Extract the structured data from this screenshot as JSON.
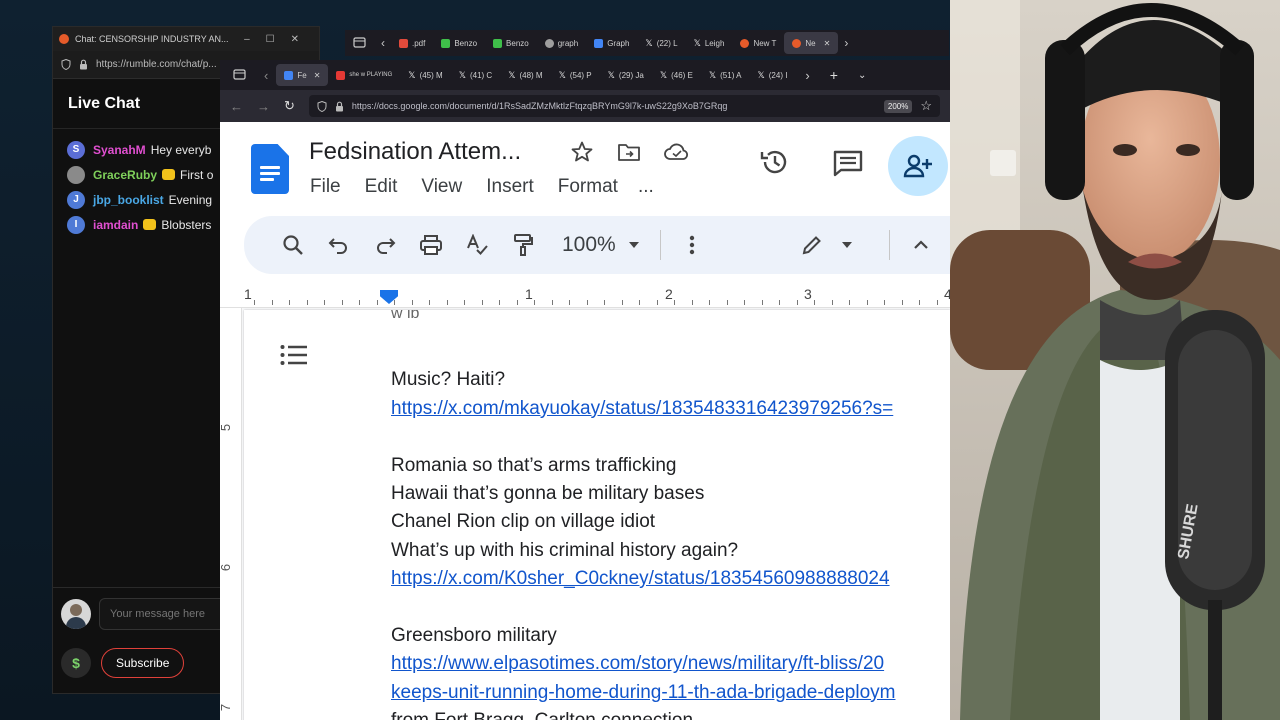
{
  "back_window": {
    "title": "Chat: CENSORSHIP INDUSTRY AN...",
    "url": "https://rumble.com/chat/p...",
    "controls": [
      "–",
      "☐",
      "✕"
    ]
  },
  "live_chat": {
    "title": "Live Chat",
    "messages": [
      {
        "initial": "S",
        "user": "SyanahM",
        "message": "Hey everyb",
        "avatar_color": "#5b6ed6",
        "user_color": "#e04fd0",
        "badge": false
      },
      {
        "initial": "",
        "user": "GraceRuby",
        "message": "First o",
        "avatar_color": "#8a8a8a",
        "user_color": "#7fd05b",
        "badge": true
      },
      {
        "initial": "J",
        "user": "jbp_booklist",
        "message": "Evening",
        "avatar_color": "#4f7ad6",
        "user_color": "#4aa8e6",
        "badge": false
      },
      {
        "initial": "I",
        "user": "iamdain",
        "message": "Blobsters",
        "avatar_color": "#4f7ad6",
        "user_color": "#e04fd0",
        "badge": true
      }
    ],
    "input_placeholder": "Your message here",
    "dollar_label": "$",
    "subscribe_label": "Subscribe"
  },
  "back_tabs": [
    {
      "label": ".pdf",
      "color": "#e24a3b"
    },
    {
      "label": "Benzo",
      "color": "#3fbf4a"
    },
    {
      "label": "Benzo",
      "color": "#3fbf4a"
    },
    {
      "label": "graph",
      "color": "#9e9e9e"
    },
    {
      "label": "Graph",
      "color": "#4285f4"
    },
    {
      "label": "(22) L",
      "color": "#eeeeee"
    },
    {
      "label": "Leigh",
      "color": "#eeeeee"
    },
    {
      "label": "New T",
      "color": "#e65b2a"
    },
    {
      "label": "Ne",
      "color": "#e65b2a"
    }
  ],
  "front_tabs": [
    {
      "label": "Fe",
      "color": "#4285f4"
    },
    {
      "label": "she w PLAYING",
      "color": "#e53935"
    },
    {
      "label": "(45) M",
      "color": "#eeeeee"
    },
    {
      "label": "(41) C",
      "color": "#eeeeee"
    },
    {
      "label": "(48) M",
      "color": "#eeeeee"
    },
    {
      "label": "(54) P",
      "color": "#eeeeee"
    },
    {
      "label": "(29) Ja",
      "color": "#eeeeee"
    },
    {
      "label": "(46) E",
      "color": "#eeeeee"
    },
    {
      "label": "(51) A",
      "color": "#eeeeee"
    },
    {
      "label": "(24) I",
      "color": "#eeeeee"
    }
  ],
  "front_url": "https://docs.google.com/document/d/1RsSadZMzMktlzFtqzqBRYmG9l7k-uwS22g9XoB7GRqg",
  "browser_zoom": "200%",
  "docs": {
    "title": "Fedsination Attem...",
    "menu": [
      "File",
      "Edit",
      "View",
      "Insert",
      "Format",
      "..."
    ],
    "zoom": "100%",
    "ruler_numbers": [
      "1",
      "1",
      "2",
      "3",
      "4"
    ],
    "vruler_numbers": [
      "5",
      "6",
      "7"
    ],
    "top_cut_text": "w ib",
    "lines": [
      {
        "text": "",
        "link": false
      },
      {
        "text": "Music? Haiti?",
        "link": false
      },
      {
        "text": "https://x.com/mkayuokay/status/1835483316423979256?s=",
        "link": true
      },
      {
        "text": "",
        "link": false
      },
      {
        "text": "Romania so that’s arms trafficking",
        "link": false
      },
      {
        "text": "Hawaii that’s gonna be military bases",
        "link": false
      },
      {
        "text": "Chanel Rion clip on village idiot",
        "link": false
      },
      {
        "text": "What’s up with his criminal history again?",
        "link": false
      },
      {
        "text": "https://x.com/K0sher_C0ckney/status/18354560988888024",
        "link": true
      },
      {
        "text": "",
        "link": false
      },
      {
        "text": "Greensboro military",
        "link": false
      },
      {
        "text": "https://www.elpasotimes.com/story/news/military/ft-bliss/20",
        "link": true
      },
      {
        "text": "keeps-unit-running-home-during-11-th-ada-brigade-deploym",
        "link": true
      },
      {
        "text": "from Fort Bragg, Carlton connection",
        "link": false
      }
    ]
  },
  "webcam": {
    "mic_brand": "SHURE"
  }
}
